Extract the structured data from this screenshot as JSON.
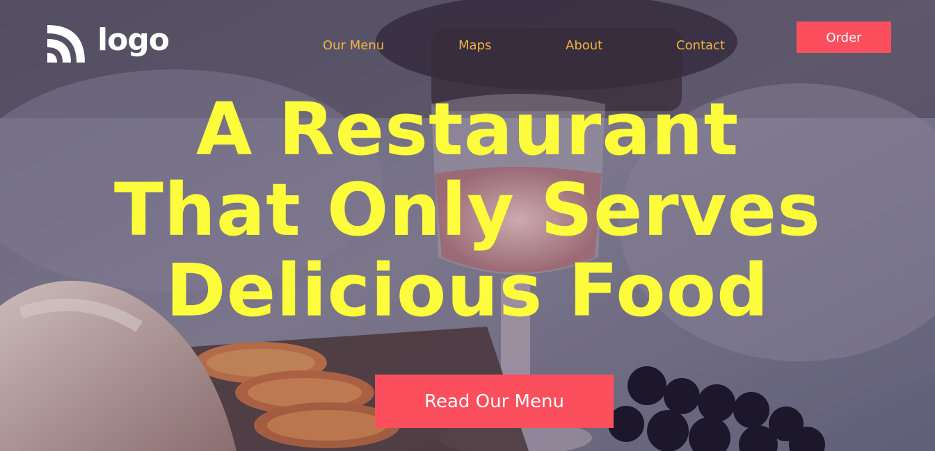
{
  "header": {
    "logo_text": "logo",
    "logo_icon": "wifi-waves-icon"
  },
  "nav": {
    "items": [
      {
        "label": "Our Menu"
      },
      {
        "label": "Maps"
      },
      {
        "label": "About"
      },
      {
        "label": "Contact"
      }
    ],
    "order_label": "Order"
  },
  "hero": {
    "headline_lines": [
      "A Restaurant",
      "That Only Serves",
      "Delicious Food"
    ],
    "cta_label": "Read Our Menu",
    "background": "photo of a table with a glass of rosé wine, bread, orange slices and grapes"
  },
  "colors": {
    "accent": "#fb4f5d",
    "headline": "#fdfd3c",
    "nav_link": "#f2b340",
    "logo": "#ffffff"
  }
}
